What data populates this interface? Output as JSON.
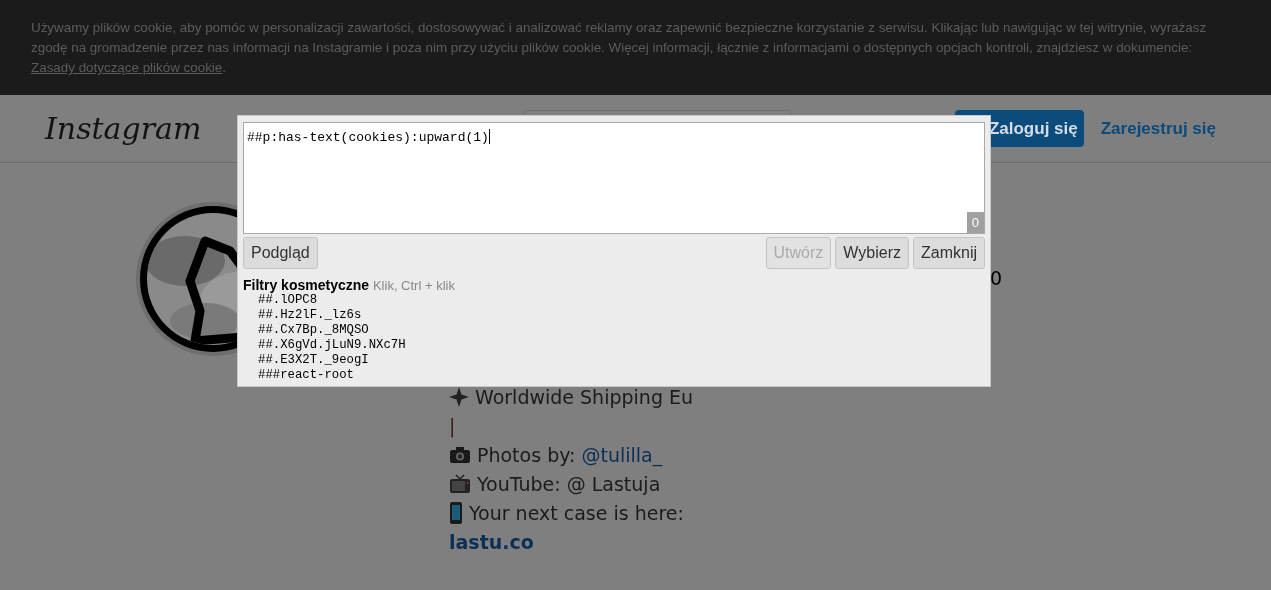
{
  "cookie_banner": {
    "text": "Używamy plików cookie, aby pomóc w personalizacji zawartości, dostosowywać i analizować reklamy oraz zapewnić bezpieczne korzystanie z serwisu. Klikając lub nawigując w tej witrynie, wyrażasz zgodę na gromadzenie przez nas informacji na Instagramie i poza nim przy użyciu plików cookie. Więcej informacji, łącznie z informacjami o dostępnych opcjach kontroli, znajdziesz w dokumencie:",
    "link": "Zasady dotyczące plików cookie",
    "after_link": "."
  },
  "header": {
    "logo": "Instagram",
    "login_button": "Zaloguj się",
    "register_link": "Zarejestruj się"
  },
  "profile": {
    "stat": "0",
    "bio": [
      {
        "kind": "sparkle",
        "text": "Worldwide Shipping Eu"
      },
      {
        "kind": "bar",
        "text": "|"
      },
      {
        "kind": "camera",
        "text": "Photos by: ",
        "link": "@tulilla_"
      },
      {
        "kind": "tv",
        "text": "YouTube: @ Lastuja"
      },
      {
        "kind": "phone",
        "text": "Your next case is here:"
      },
      {
        "kind": "website",
        "text": "lastu.co"
      }
    ]
  },
  "filter_dialog": {
    "input_value": "##p:has-text(cookies):upward(1)",
    "counter": "0",
    "left_buttons": [
      {
        "label": "Podgląd",
        "disabled": false
      }
    ],
    "right_buttons": [
      {
        "label": "Utwórz",
        "disabled": true
      },
      {
        "label": "Wybierz",
        "disabled": false
      },
      {
        "label": "Zamknij",
        "disabled": false
      }
    ],
    "section_title": "Filtry kosmetyczne",
    "section_hint": "Klik, Ctrl + klik",
    "filters": [
      "##.lOPC8",
      "##.Hz2lF._lz6s",
      "##.Cx7Bp._8MQSO",
      "##.X6gVd.jLuN9.NXc7H",
      "##.E3X2T._9eogI",
      "###react-root"
    ]
  }
}
